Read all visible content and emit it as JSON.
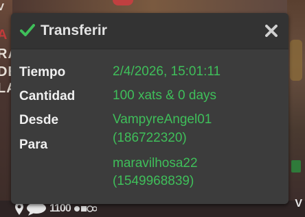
{
  "dialog": {
    "title": "Transferir",
    "rows": {
      "tiempo": {
        "label": "Tiempo",
        "value": "2/4/2026, 15:01:11"
      },
      "cantidad": {
        "label": "Cantidad",
        "value": "100 xats & 0 days"
      },
      "desde": {
        "label": "Desde",
        "name": "VampyreAngel01",
        "id": "(186722320)"
      },
      "para": {
        "label": "Para",
        "name": "maravilhosa22",
        "id": "(1549968839)"
      }
    },
    "colors": {
      "accent": "#3fbf5a",
      "background": "#3c3c3c",
      "header": "#333333"
    }
  },
  "background": {
    "left_letters": [
      "V",
      "A",
      "RA",
      "DE",
      "LA"
    ],
    "bottom_text": "1100",
    "right_letter": "V"
  }
}
